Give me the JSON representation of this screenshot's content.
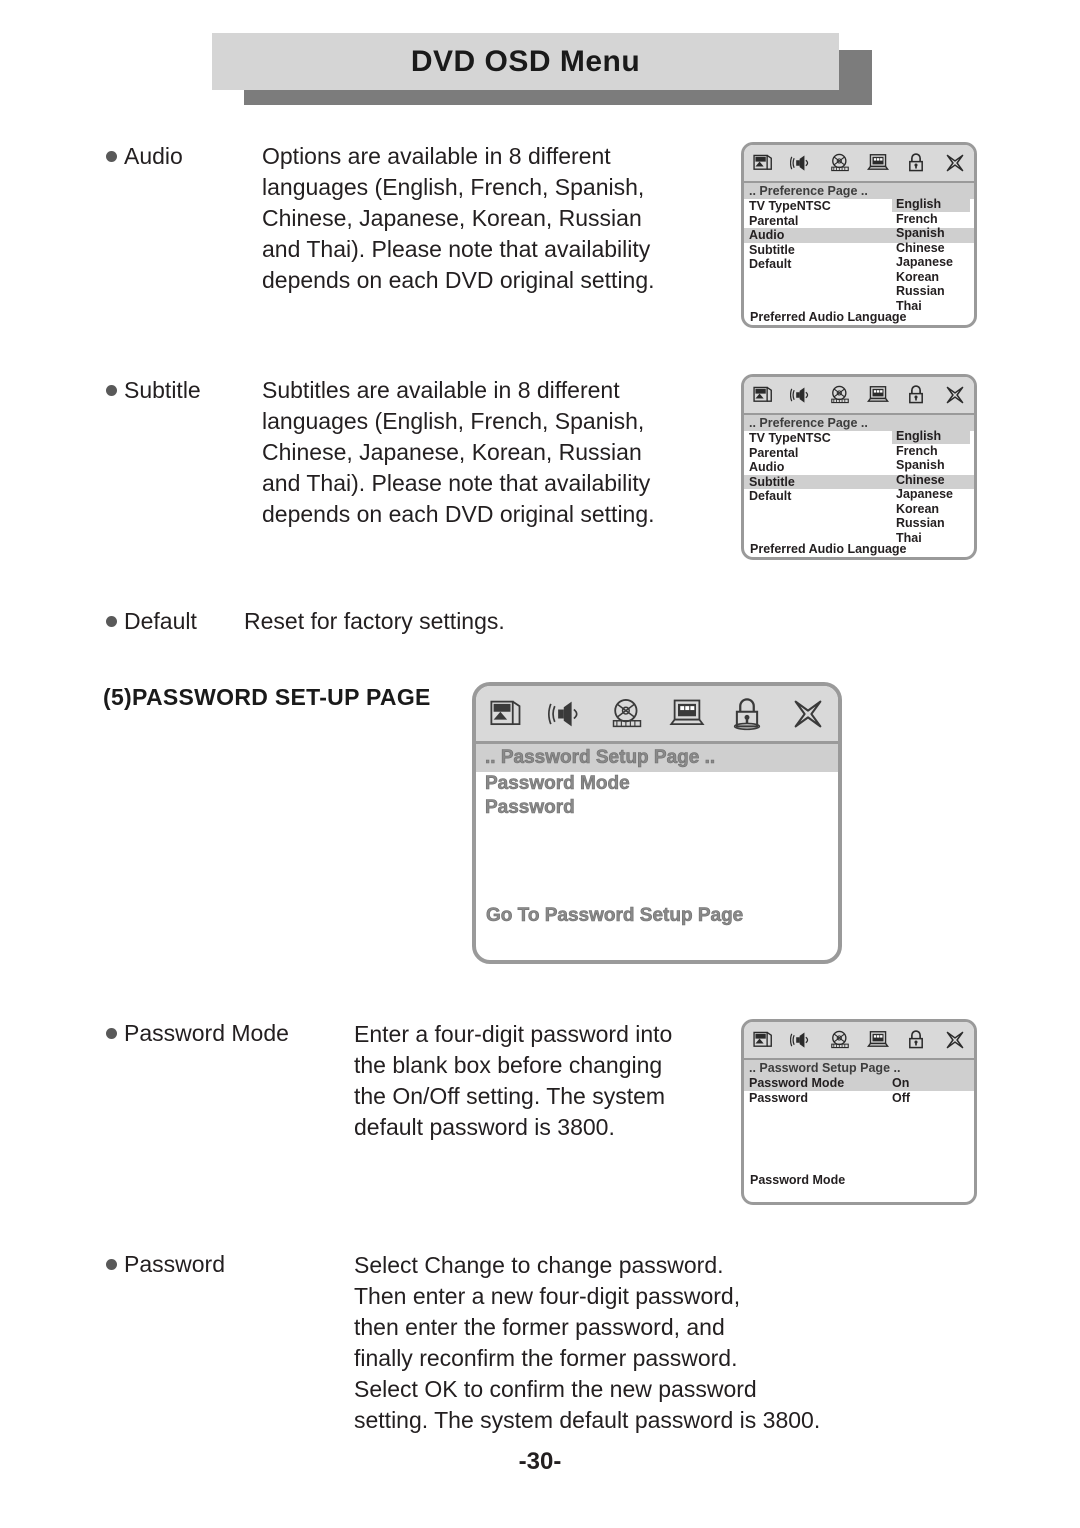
{
  "header": {
    "title": "DVD OSD Menu"
  },
  "sections": {
    "audio": {
      "term": "Audio",
      "description": "Options are available in 8 different\nlanguages (English, French, Spanish,\nChinese, Japanese, Korean, Russian\nand Thai). Please note that availability\ndepends on each DVD original setting."
    },
    "subtitle": {
      "term": "Subtitle",
      "description": "Subtitles are available in 8 different\nlanguages (English, French, Spanish,\nChinese, Japanese, Korean, Russian\nand Thai). Please note that availability\ndepends on each DVD original setting."
    },
    "default": {
      "term": "Default",
      "description": "Reset for factory settings."
    },
    "password_setup_heading": "(5)PASSWORD SET-UP PAGE",
    "password_mode": {
      "term": "Password Mode",
      "description": "Enter a four-digit password into\nthe blank box before changing\nthe On/Off setting. The system\ndefault password is 3800."
    },
    "password": {
      "term": "Password",
      "description": "Select Change to change password.\nThen enter a new four-digit password,\nthen enter the former password, and\nfinally reconfirm the former password.\nSelect OK to confirm the new password\nsetting. The system default password is 3800."
    }
  },
  "osd_icons": [
    "picture-icon",
    "speaker-icon",
    "film-reel-icon",
    "monitor-icon",
    "padlock-icon",
    "close-x-icon"
  ],
  "panels": {
    "preference_audio": {
      "title": ".. Preference Page ..",
      "menu_items": [
        "TV TypeNTSC",
        "Parental",
        "Audio",
        "Subtitle",
        "Default"
      ],
      "selected_menu_item": "Audio",
      "languages": [
        "English",
        "French",
        "Spanish",
        "Chinese",
        "Japanese",
        "Korean",
        "Russian",
        "Thai"
      ],
      "selected_language": "English",
      "footer": "Preferred Audio Language"
    },
    "preference_subtitle": {
      "title": ".. Preference Page ..",
      "menu_items": [
        "TV TypeNTSC",
        "Parental",
        "Audio",
        "Subtitle",
        "Default"
      ],
      "selected_menu_item": "Subtitle",
      "languages": [
        "English",
        "French",
        "Spanish",
        "Chinese",
        "Japanese",
        "Korean",
        "Russian",
        "Thai"
      ],
      "selected_language": "English",
      "footer": "Preferred Audio Language"
    },
    "password_setup_large": {
      "title": ".. Password Setup Page ..",
      "lines": [
        "Password Mode",
        "Password"
      ],
      "footer": "Go To Password Setup Page"
    },
    "password_setup_small": {
      "title": ".. Password Setup Page ..",
      "rows": [
        {
          "label": "Password Mode",
          "value": "On",
          "highlighted": true
        },
        {
          "label": "Password",
          "value": "Off",
          "highlighted": false
        }
      ],
      "footer": "Password Mode"
    }
  },
  "page_number": "-30-",
  "colors": {
    "panel_border": "#9a9a9a",
    "highlight": "#cfcfcf",
    "iconbar": "#d9d9d9",
    "header_bar": "#d5d5d5",
    "header_shadow": "#7c7c7c",
    "bullet": "#595959",
    "text": "#231f20"
  }
}
